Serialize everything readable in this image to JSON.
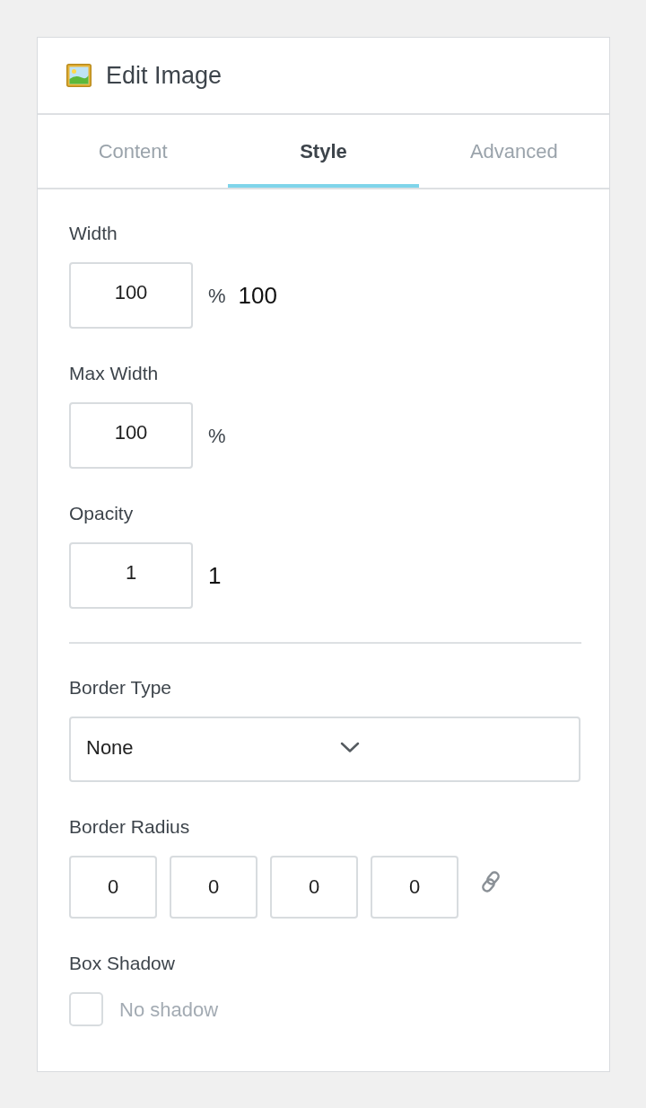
{
  "panel": {
    "title": "Edit Image"
  },
  "tabs": [
    {
      "label": "Content",
      "selected": false
    },
    {
      "label": "Style",
      "selected": true
    },
    {
      "label": "Advanced",
      "selected": false
    }
  ],
  "fields": [
    {
      "kind": "number",
      "label": "Width",
      "value": "100",
      "unit": "%",
      "reading": "100"
    },
    {
      "kind": "number",
      "label": "Max Width",
      "value": "100",
      "unit": "%"
    },
    {
      "kind": "number",
      "label": "Opacity",
      "value": "1",
      "reading": "1"
    },
    {
      "kind": "divider"
    },
    {
      "kind": "select",
      "label": "Border Type",
      "value": "None"
    },
    {
      "kind": "quad",
      "label": "Border Radius",
      "values": [
        "0",
        "0",
        "0",
        "0"
      ]
    },
    {
      "kind": "checkbox",
      "label": "Box Shadow",
      "option": "No shadow",
      "checked": false
    }
  ]
}
